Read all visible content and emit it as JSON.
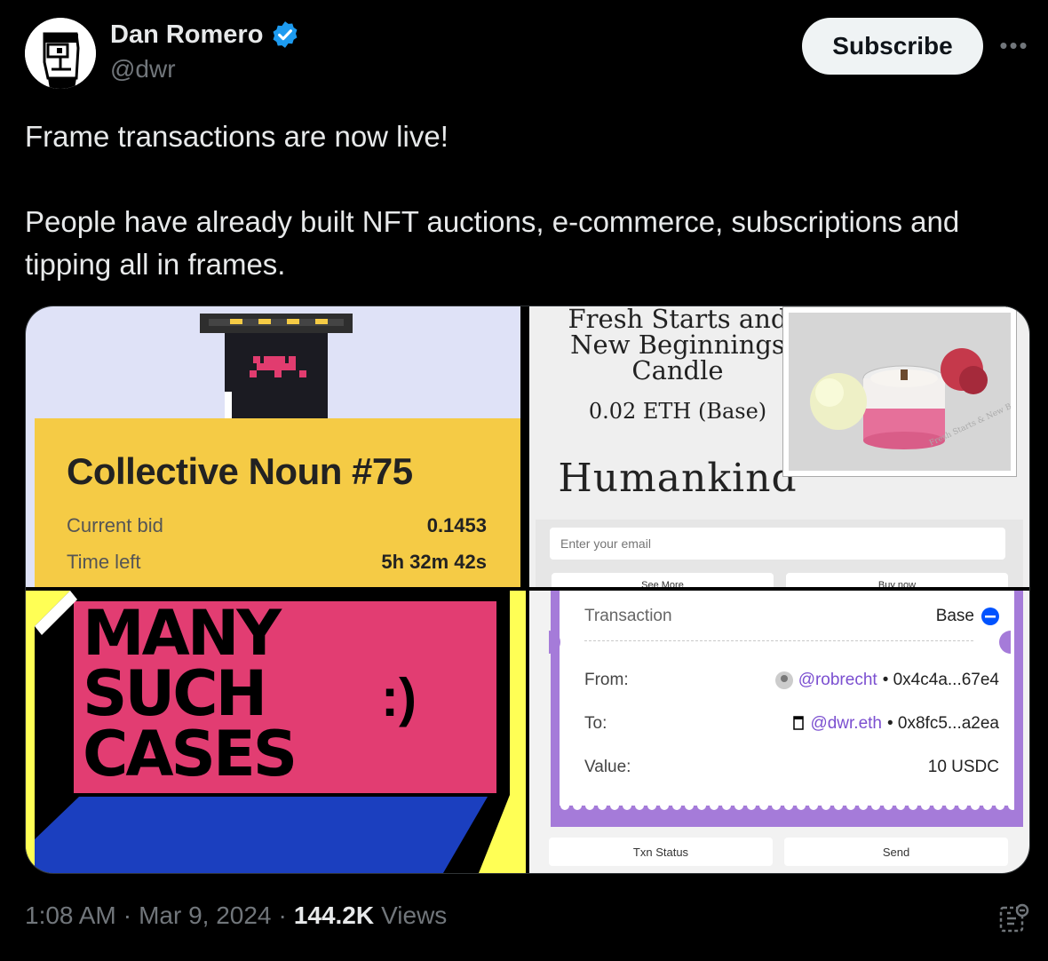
{
  "author": {
    "name": "Dan Romero",
    "handle": "@dwr",
    "verified_color": "#1d9bf0"
  },
  "actions": {
    "subscribe": "Subscribe",
    "more": "•••"
  },
  "tweet": {
    "line1": "Frame transactions are now live!",
    "line2": "People have already built NFT auctions, e-commerce, subscriptions and tipping all in frames."
  },
  "auction": {
    "title": "Collective Noun #75",
    "bid_label": "Current bid",
    "bid_value": "0.1453",
    "time_label": "Time left",
    "time_value": "5h 32m 42s"
  },
  "shop": {
    "title_l1": "Fresh Starts and",
    "title_l2": "New Beginnings",
    "title_l3": "Candle",
    "price": "0.02 ETH (Base)",
    "brand": "Humankind",
    "photo_caption": "Fresh Starts & New Beginnings",
    "email_placeholder": "Enter your email",
    "see_more": "See More",
    "buy_now": "Buy now"
  },
  "cases": {
    "line1": "MANY",
    "line2": "SUCH",
    "line3": "CASES",
    "smile": ":)"
  },
  "transaction": {
    "label": "Transaction",
    "network": "Base",
    "from_label": "From:",
    "from_handle": "@robrecht",
    "from_addr": "• 0x4c4a...67e4",
    "to_label": "To:",
    "to_handle": "@dwr.eth",
    "to_addr": "• 0x8fc5...a2ea",
    "value_label": "Value:",
    "value": "10 USDC",
    "status_btn": "Txn Status",
    "send_btn": "Send"
  },
  "meta": {
    "time": "1:08 AM",
    "date": "Mar 9, 2024",
    "sep": "·",
    "views": "144.2K",
    "views_label": "Views"
  }
}
